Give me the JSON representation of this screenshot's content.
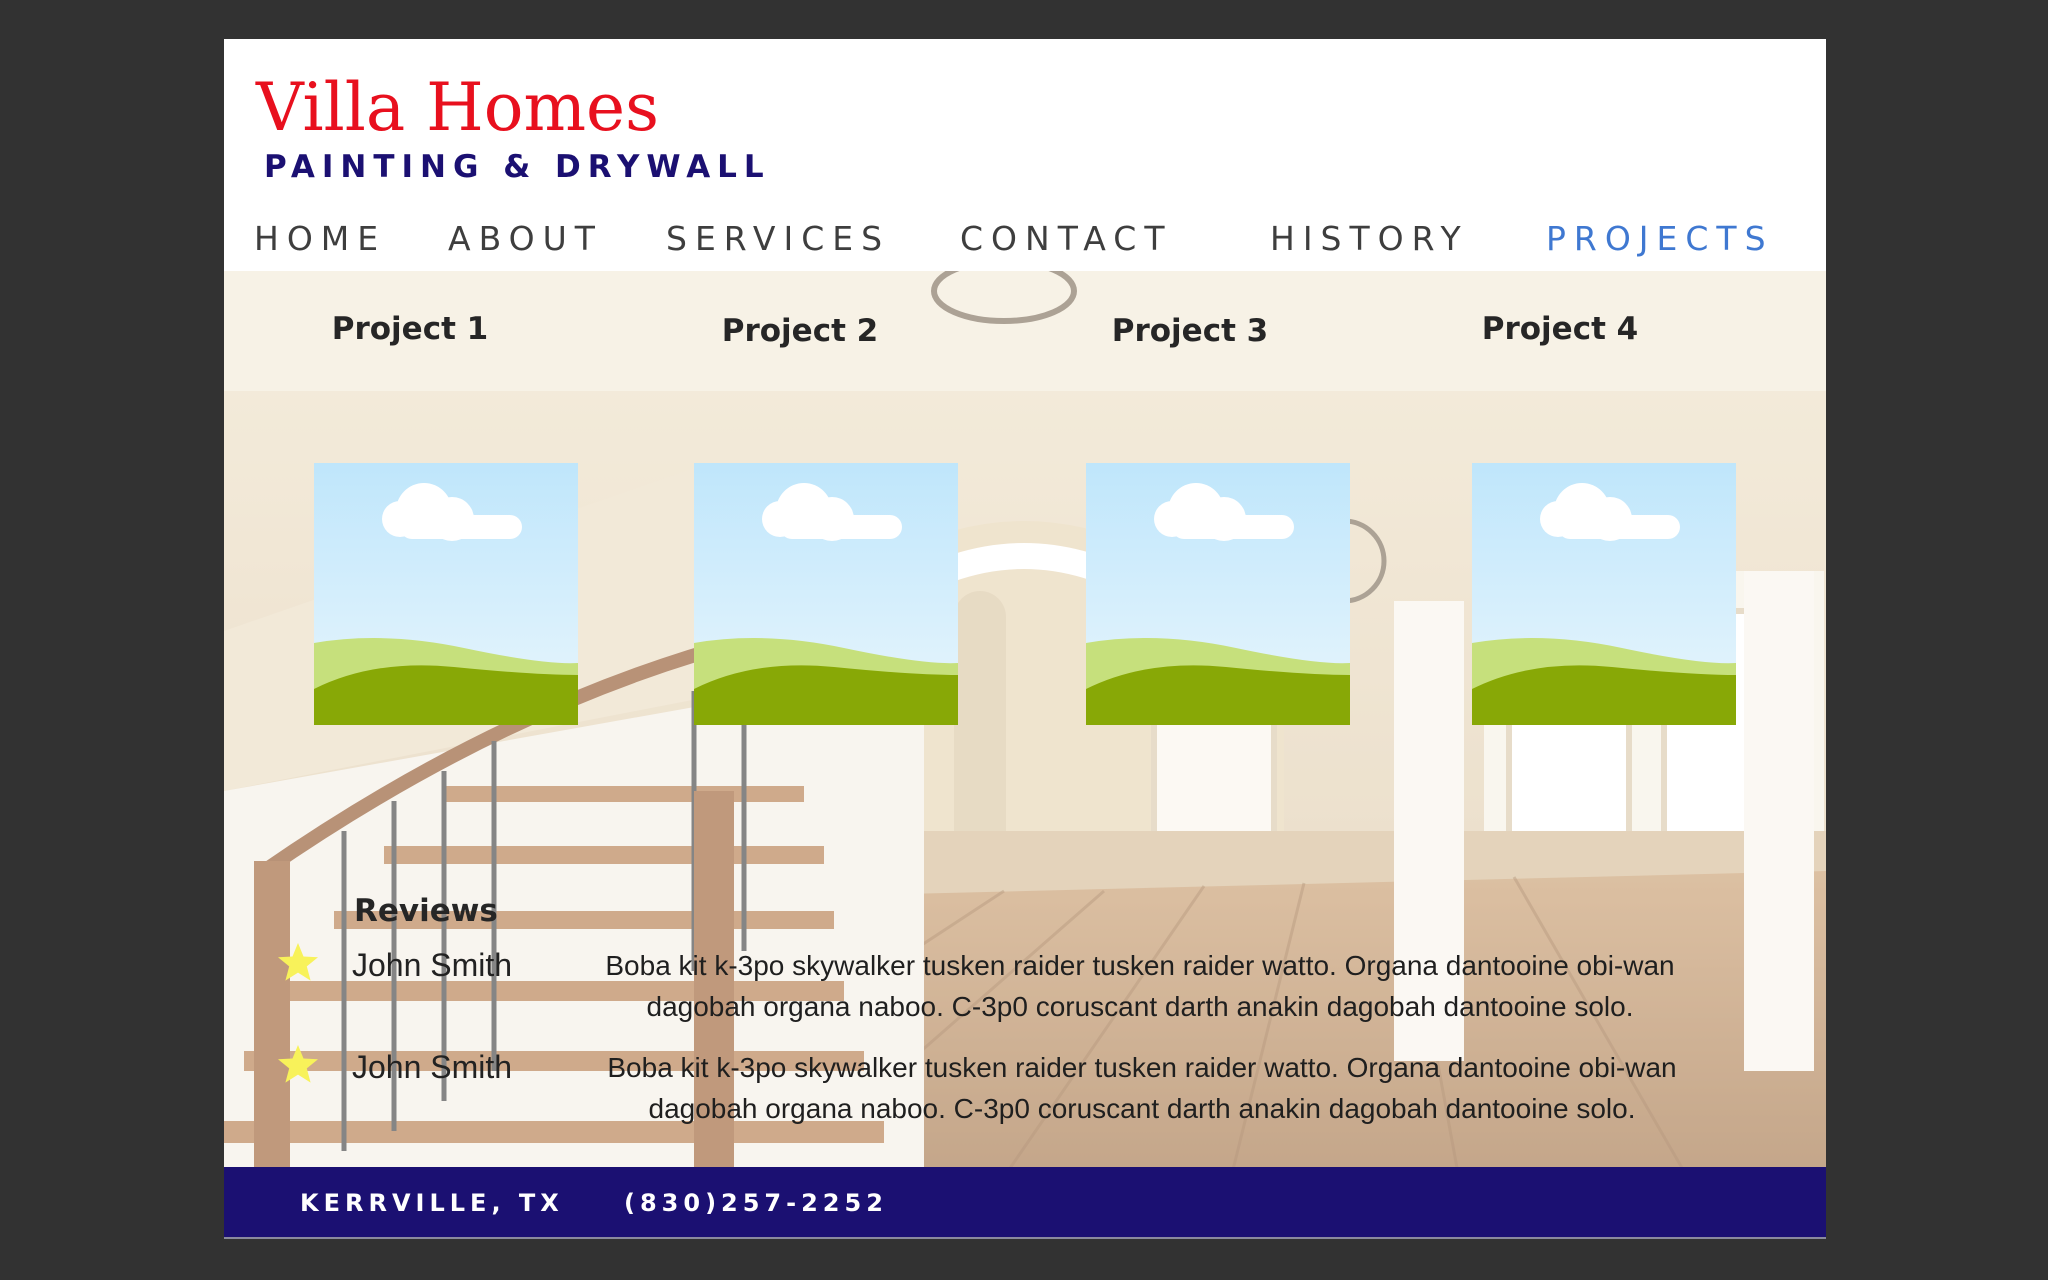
{
  "brand": {
    "title": "Villa Homes",
    "subtitle": "PAINTING & DRYWALL",
    "title_color": "#e8101e",
    "subtitle_color": "#1b1072"
  },
  "nav": {
    "items": [
      {
        "label": "HOME"
      },
      {
        "label": "ABOUT"
      },
      {
        "label": "SERVICES"
      },
      {
        "label": "CONTACT"
      },
      {
        "label": "HISTORY"
      },
      {
        "label": "PROJECTS",
        "active": true
      }
    ],
    "active_color": "#3f78d1"
  },
  "projects": [
    {
      "title": "Project 1",
      "image": "landscape-placeholder-icon"
    },
    {
      "title": "Project 2",
      "image": "landscape-placeholder-icon"
    },
    {
      "title": "Project 3",
      "image": "landscape-placeholder-icon"
    },
    {
      "title": "Project 4",
      "image": "landscape-placeholder-icon"
    }
  ],
  "reviews": {
    "title": "Reviews",
    "items": [
      {
        "icon": "star-icon",
        "name": "John Smith",
        "text": "Boba kit k-3po skywalker tusken raider tusken raider watto. Organa dantooine obi-wan dagobah organa naboo. C-3p0 coruscant darth anakin dagobah dantooine solo."
      },
      {
        "icon": "star-icon",
        "name": "John Smith",
        "text": "Boba kit k-3po skywalker tusken raider tusken raider watto. Organa dantooine obi-wan dagobah organa naboo. C-3p0 coruscant darth anakin dagobah dantooine solo."
      }
    ],
    "star_color": "#f8f25a"
  },
  "footer": {
    "location": "KERRVILLE, TX",
    "phone": "(830)257-2252",
    "background": "#1b1072"
  }
}
